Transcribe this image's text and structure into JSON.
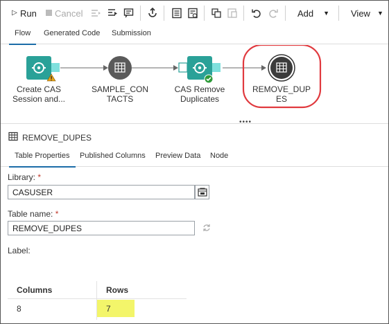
{
  "toolbar": {
    "run_label": "Run",
    "cancel_label": "Cancel",
    "add_label": "Add",
    "view_label": "View"
  },
  "top_tabs": [
    "Flow",
    "Generated Code",
    "Submission"
  ],
  "flow": {
    "nodes": [
      {
        "line1": "Create CAS",
        "line2": "Session and..."
      },
      {
        "line1": "SAMPLE_CON",
        "line2": "TACTS"
      },
      {
        "line1": "CAS Remove",
        "line2": "Duplicates"
      },
      {
        "line1": "REMOVE_DUP",
        "line2": "ES"
      }
    ],
    "highlight_color": "#e0393e",
    "node_color_teal": "#2aa198",
    "node_color_gray": "#5a5a5a"
  },
  "panel": {
    "title": "REMOVE_DUPES",
    "tabs": [
      "Table Properties",
      "Published Columns",
      "Preview Data",
      "Node"
    ],
    "library_label": "Library:",
    "library_value": "CASUSER",
    "table_name_label": "Table name:",
    "table_name_value": "REMOVE_DUPES",
    "label_label": "Label:",
    "required_mark": "*"
  },
  "stats": {
    "columns_header": "Columns",
    "rows_header": "Rows",
    "columns_value": "8",
    "rows_value": "7"
  }
}
